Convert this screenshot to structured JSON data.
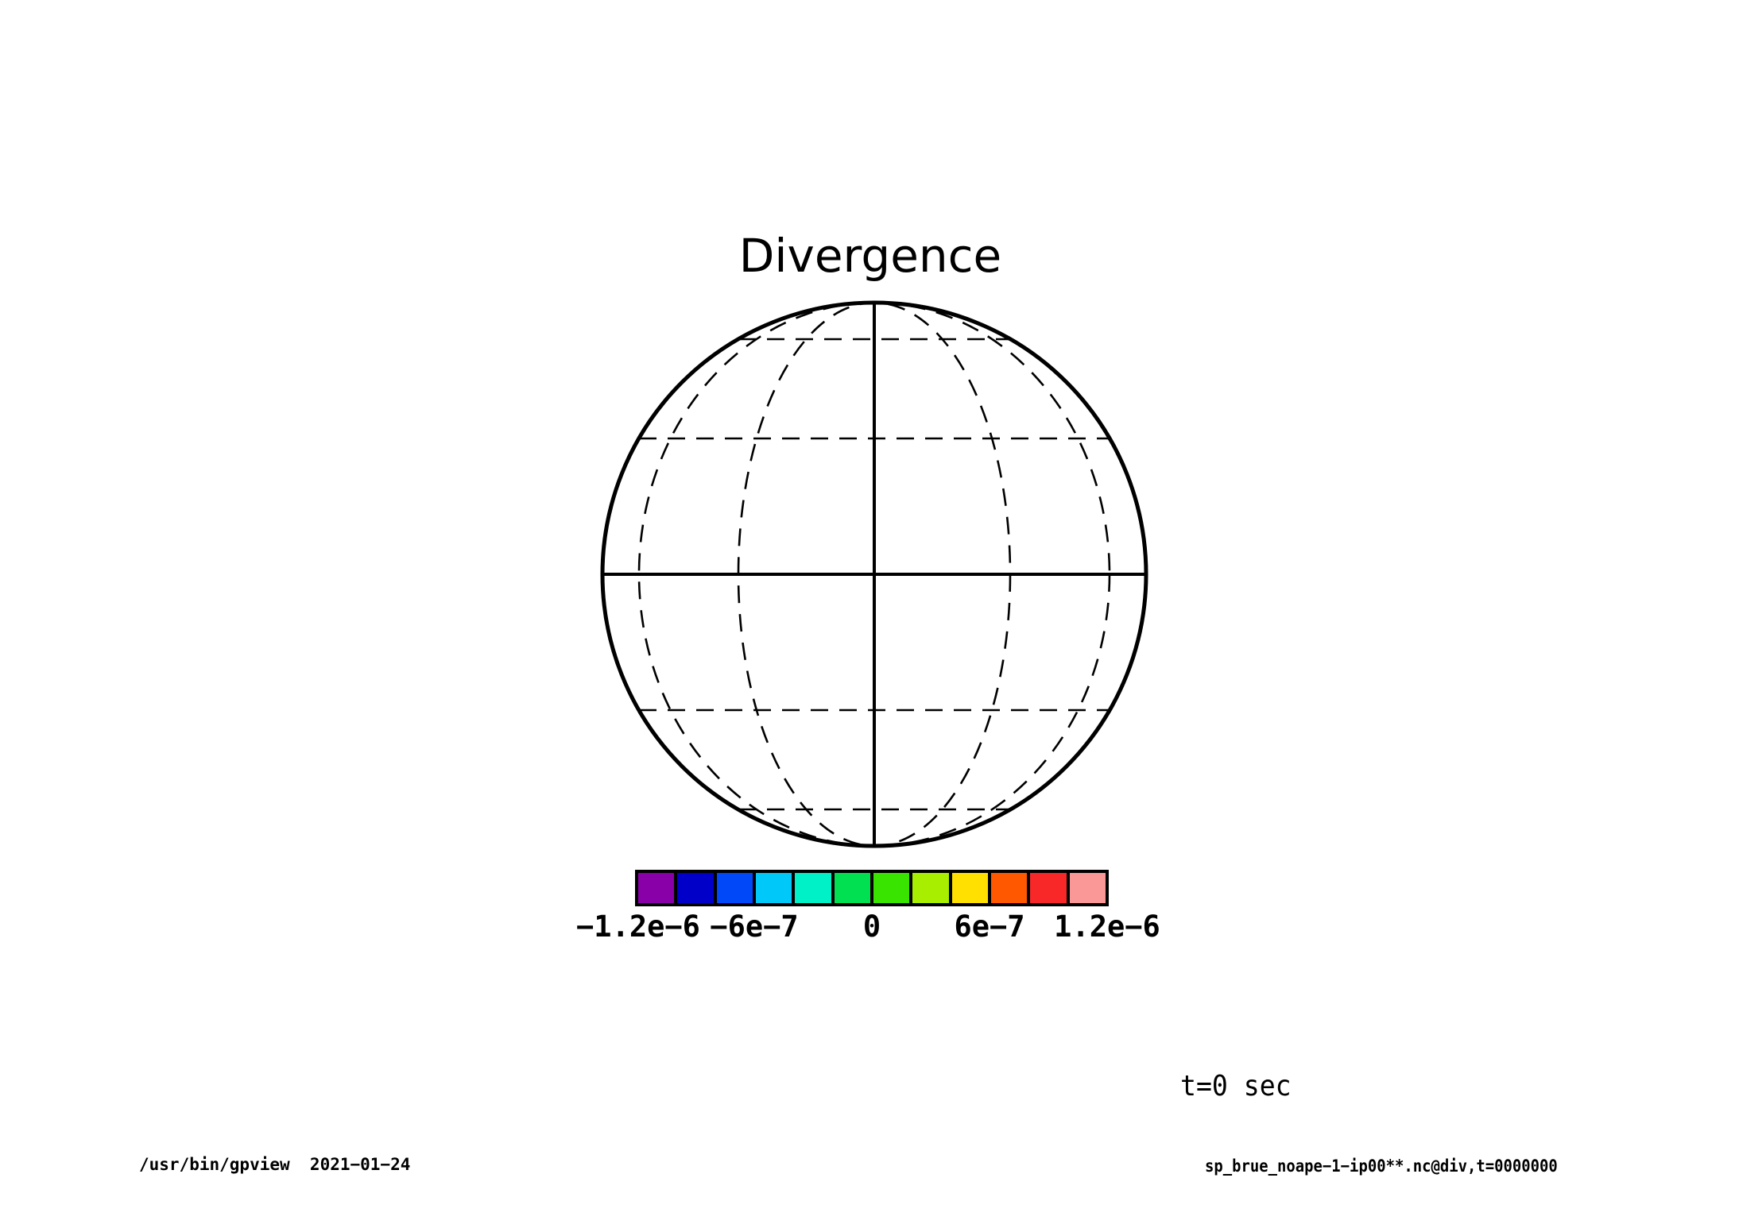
{
  "title": "Divergence",
  "time_label": "t=0 sec",
  "footer": {
    "left": "/usr/bin/gpview  2021−01−24",
    "right": "sp_brue_noape−1−ip00**.nc@div,t=0000000"
  },
  "colorbar": {
    "colors": [
      "#8A00A8",
      "#0000C8",
      "#0048F8",
      "#00C8F8",
      "#00F0C8",
      "#00E050",
      "#38E400",
      "#A8EE00",
      "#FFE000",
      "#FF5800",
      "#F82828",
      "#FA9898"
    ],
    "tick_labels": [
      "−1.2e−6",
      "−6e−7",
      "0",
      "6e−7",
      "1.2e−6"
    ]
  },
  "chart_data": {
    "type": "heatmap",
    "title": "Divergence",
    "annotation": "t=0 sec",
    "projection": "orthographic globe, equatorial view, graticule every 30 degrees (solid equator and central meridian, dashed parallels at ±30/±60 and meridians at ±30/±60)",
    "field_note": "no filled contours are drawn inside the globe (divergence field is blank/zero at t=0)",
    "colorbar_levels": [
      -1.2e-06,
      -1e-06,
      -8e-07,
      -6e-07,
      -4e-07,
      -2e-07,
      0,
      2e-07,
      4e-07,
      6e-07,
      8e-07,
      1e-06,
      1.2e-06
    ],
    "colorbar_colors": [
      "#8A00A8",
      "#0000C8",
      "#0048F8",
      "#00C8F8",
      "#00F0C8",
      "#00E050",
      "#38E400",
      "#A8EE00",
      "#FFE000",
      "#FF5800",
      "#F82828",
      "#FA9898"
    ],
    "colorbar_tick_labels": [
      "−1.2e−6",
      "−6e−7",
      "0",
      "6e−7",
      "1.2e−6"
    ],
    "colorbar_tick_positions": [
      0,
      0.25,
      0.5,
      0.75,
      1.0
    ],
    "legend_position": "bottom",
    "grid": "dashed graticule"
  }
}
